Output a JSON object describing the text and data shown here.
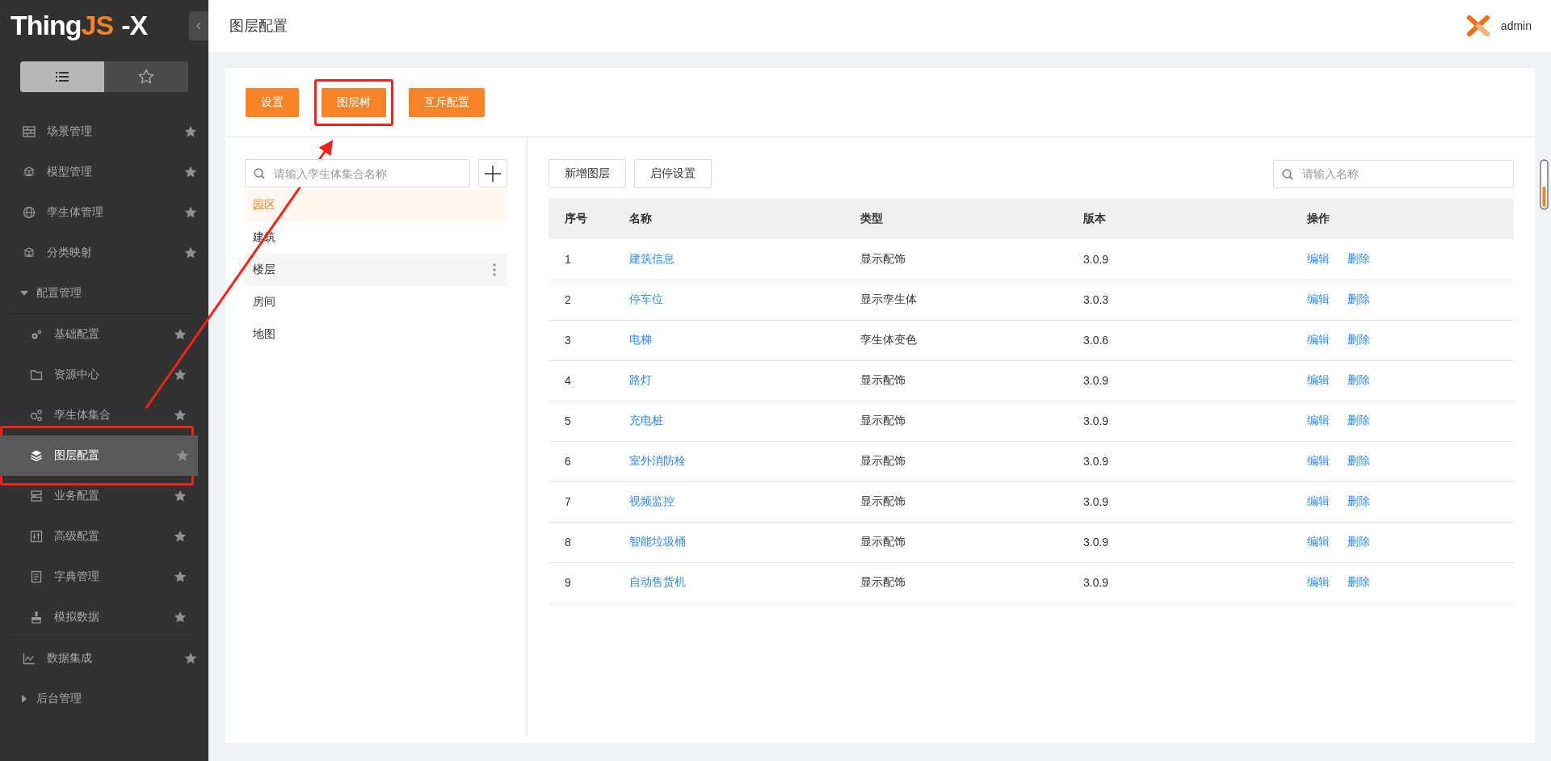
{
  "sidebar": {
    "logo": {
      "text": "Thing",
      "accent": "JS",
      "suffix": "-X"
    },
    "view_toggle": [
      {
        "selected": true
      },
      {
        "selected": false
      }
    ],
    "items": [
      {
        "kind": "link",
        "label": "场景管理",
        "selected": false,
        "highlighted": false
      },
      {
        "kind": "link",
        "label": "模型管理",
        "selected": false,
        "highlighted": false
      },
      {
        "kind": "link",
        "label": "孪生体管理",
        "selected": false,
        "highlighted": false
      },
      {
        "kind": "link",
        "label": "分类映射",
        "selected": false,
        "highlighted": false
      },
      {
        "kind": "group",
        "label": "配置管理",
        "expanded": true,
        "children": [
          {
            "kind": "link",
            "label": "基础配置",
            "selected": false,
            "highlighted": false
          },
          {
            "kind": "link",
            "label": "资源中心",
            "selected": false,
            "highlighted": false
          },
          {
            "kind": "link",
            "label": "孪生体集合",
            "selected": false,
            "highlighted": false
          },
          {
            "kind": "link",
            "label": "图层配置",
            "selected": true,
            "highlighted": true
          },
          {
            "kind": "link",
            "label": "业务配置",
            "selected": false,
            "highlighted": false
          },
          {
            "kind": "link",
            "label": "高级配置",
            "selected": false,
            "highlighted": false
          },
          {
            "kind": "link",
            "label": "字典管理",
            "selected": false,
            "highlighted": false
          },
          {
            "kind": "link",
            "label": "模拟数据",
            "selected": false,
            "highlighted": false
          }
        ]
      },
      {
        "kind": "link",
        "label": "数据集成",
        "selected": false,
        "highlighted": false
      },
      {
        "kind": "group",
        "label": "后台管理",
        "expanded": false
      }
    ]
  },
  "header": {
    "title": "图层配置",
    "user": "admin"
  },
  "tabs": [
    {
      "label": "设置",
      "highlighted": false
    },
    {
      "label": "图层树",
      "highlighted": true
    },
    {
      "label": "互斥配置",
      "highlighted": false
    }
  ],
  "tree": {
    "search": {
      "placeholder": "请输入孪生体集合名称"
    },
    "items": [
      {
        "label": "园区",
        "selected": true,
        "hovered": false
      },
      {
        "label": "建筑",
        "selected": false,
        "hovered": false
      },
      {
        "label": "楼层",
        "selected": false,
        "hovered": true
      },
      {
        "label": "房间",
        "selected": false,
        "hovered": false
      },
      {
        "label": "地图",
        "selected": false,
        "hovered": false
      }
    ]
  },
  "layers": {
    "buttons": [
      "新增图层",
      "启停设置"
    ],
    "search": {
      "placeholder": "请输入名称"
    },
    "columns": [
      "序号",
      "名称",
      "类型",
      "版本",
      "操作"
    ],
    "rows": [
      {
        "index": "1",
        "name": "建筑信息",
        "type": "显示配饰",
        "version": "3.0.9",
        "actions": [
          "编辑",
          "删除"
        ]
      },
      {
        "index": "2",
        "name": "停车位",
        "type": "显示孪生体",
        "version": "3.0.3",
        "actions": [
          "编辑",
          "删除"
        ]
      },
      {
        "index": "3",
        "name": "电梯",
        "type": "孪生体变色",
        "version": "3.0.6",
        "actions": [
          "编辑",
          "删除"
        ]
      },
      {
        "index": "4",
        "name": "路灯",
        "type": "显示配饰",
        "version": "3.0.9",
        "actions": [
          "编辑",
          "删除"
        ]
      },
      {
        "index": "5",
        "name": "充电桩",
        "type": "显示配饰",
        "version": "3.0.9",
        "actions": [
          "编辑",
          "删除"
        ]
      },
      {
        "index": "6",
        "name": "室外消防栓",
        "type": "显示配饰",
        "version": "3.0.9",
        "actions": [
          "编辑",
          "删除"
        ]
      },
      {
        "index": "7",
        "name": "视频监控",
        "type": "显示配饰",
        "version": "3.0.9",
        "actions": [
          "编辑",
          "删除"
        ]
      },
      {
        "index": "8",
        "name": "智能垃圾桶",
        "type": "显示配饰",
        "version": "3.0.9",
        "actions": [
          "编辑",
          "删除"
        ]
      },
      {
        "index": "9",
        "name": "自动售货机",
        "type": "显示配饰",
        "version": "3.0.9",
        "actions": [
          "编辑",
          "删除"
        ]
      }
    ]
  }
}
